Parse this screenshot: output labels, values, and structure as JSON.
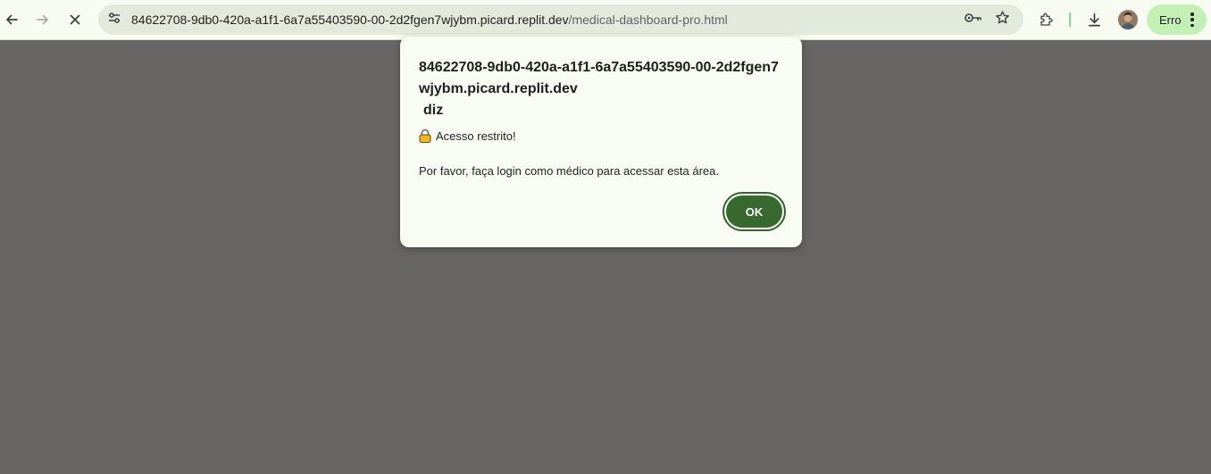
{
  "browser": {
    "url_host": "84622708-9db0-420a-a1f1-6a7a55403590-00-2d2fgen7wjybm.picard.replit.dev",
    "url_path": "/medical-dashboard-pro.html",
    "error_chip_label": "Erro",
    "icons": {
      "back": "back-arrow-icon",
      "forward": "forward-arrow-icon",
      "stop": "close-icon",
      "site_info": "tune-icon",
      "password": "key-icon",
      "bookmark": "star-icon",
      "extensions": "puzzle-icon",
      "downloads": "download-icon",
      "profile": "avatar",
      "menu": "kebab-menu-icon"
    }
  },
  "dialog": {
    "title": "84622708-9db0-420a-a1f1-6a7a55403590-00-2d2fgen7wjybm.picard.replit.dev",
    "title_suffix": "diz",
    "line1": "Acesso restrito!",
    "line2": "Por favor, faça login como médico para acessar esta área.",
    "ok_label": "OK",
    "lock_emoji": "🔒"
  },
  "colors": {
    "overlay": "#666564",
    "toolbar": "#f7fbf1",
    "omnibox": "#e3eadb",
    "dialog_bg": "#f8fcf2",
    "ok_button": "#386a30",
    "error_chip": "#c2f0b5"
  }
}
